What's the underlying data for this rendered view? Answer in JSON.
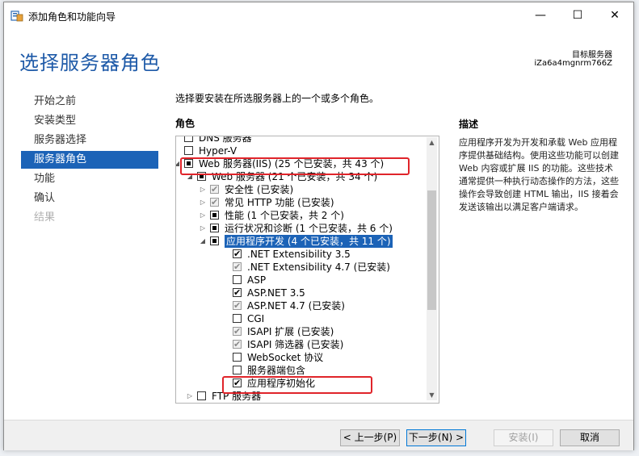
{
  "window": {
    "title": "添加角色和功能向导",
    "minimize_glyph": "—",
    "maximize_glyph": "☐",
    "close_glyph": "✕"
  },
  "header": {
    "title": "选择服务器角色",
    "destination_label": "目标服务器",
    "destination_server": "iZa6a4mgnrm766Z"
  },
  "nav": {
    "items": [
      {
        "label": "开始之前",
        "state": "normal"
      },
      {
        "label": "安装类型",
        "state": "normal"
      },
      {
        "label": "服务器选择",
        "state": "normal"
      },
      {
        "label": "服务器角色",
        "state": "active"
      },
      {
        "label": "功能",
        "state": "normal"
      },
      {
        "label": "确认",
        "state": "normal"
      },
      {
        "label": "结果",
        "state": "disabled"
      }
    ]
  },
  "main": {
    "intro": "选择要安装在所选服务器上的一个或多个角色。",
    "roles_header": "角色",
    "tree": [
      {
        "label": "DNS 服务器",
        "checkbox": "none",
        "expander": "",
        "level": 0
      },
      {
        "label": "Hyper-V",
        "checkbox": "none",
        "expander": "",
        "level": 0
      },
      {
        "label": "Web 服务器(IIS) (25 个已安装，共 43 个)",
        "checkbox": "partial",
        "expander": "◢",
        "level": 0
      },
      {
        "label": "Web 服务器 (21 个已安装，共 34 个)",
        "checkbox": "partial",
        "expander": "◢",
        "level": 1
      },
      {
        "label": "安全性 (已安装)",
        "checkbox": "grey-checked",
        "expander": "▷",
        "level": 2
      },
      {
        "label": "常见 HTTP 功能 (已安装)",
        "checkbox": "grey-checked",
        "expander": "▷",
        "level": 2
      },
      {
        "label": "性能 (1 个已安装，共 2 个)",
        "checkbox": "partial",
        "expander": "▷",
        "level": 2
      },
      {
        "label": "运行状况和诊断 (1 个已安装，共 6 个)",
        "checkbox": "partial",
        "expander": "▷",
        "level": 2
      },
      {
        "label": "应用程序开发 (4 个已安装，共 11 个)",
        "checkbox": "partial",
        "expander": "◢",
        "level": 2,
        "selected": true
      },
      {
        "label": ".NET Extensibility 3.5",
        "checkbox": "checked",
        "expander": "",
        "level": 3
      },
      {
        "label": ".NET Extensibility 4.7 (已安装)",
        "checkbox": "grey-checked",
        "expander": "",
        "level": 3
      },
      {
        "label": "ASP",
        "checkbox": "none",
        "expander": "",
        "level": 3
      },
      {
        "label": "ASP.NET 3.5",
        "checkbox": "checked",
        "expander": "",
        "level": 3
      },
      {
        "label": "ASP.NET 4.7 (已安装)",
        "checkbox": "grey-checked",
        "expander": "",
        "level": 3
      },
      {
        "label": "CGI",
        "checkbox": "none",
        "expander": "",
        "level": 3
      },
      {
        "label": "ISAPI 扩展 (已安装)",
        "checkbox": "grey-checked",
        "expander": "",
        "level": 3
      },
      {
        "label": "ISAPI 筛选器 (已安装)",
        "checkbox": "grey-checked",
        "expander": "",
        "level": 3
      },
      {
        "label": "WebSocket 协议",
        "checkbox": "none",
        "expander": "",
        "level": 3
      },
      {
        "label": "服务器端包含",
        "checkbox": "none",
        "expander": "",
        "level": 3
      },
      {
        "label": "应用程序初始化",
        "checkbox": "checked",
        "expander": "",
        "level": 3
      },
      {
        "label": "FTP 服务器",
        "checkbox": "none",
        "expander": "▷",
        "level": 1
      }
    ]
  },
  "description": {
    "header": "描述",
    "text": "应用程序开发为开发和承载 Web 应用程序提供基础结构。使用这些功能可以创建 Web 内容或扩展 IIS 的功能。这些技术通常提供一种执行动态操作的方法，这些操作会导致创建 HTML 输出，IIS 接着会发送该输出以满足客户端请求。"
  },
  "footer": {
    "prev_label": "< 上一步(P)",
    "next_label": "下一步(N) >",
    "install_label": "安装(I)",
    "cancel_label": "取消"
  },
  "colors": {
    "accent": "#1c63b7",
    "highlight_box": "#e0242a",
    "title_blue": "#1e5aa8"
  }
}
